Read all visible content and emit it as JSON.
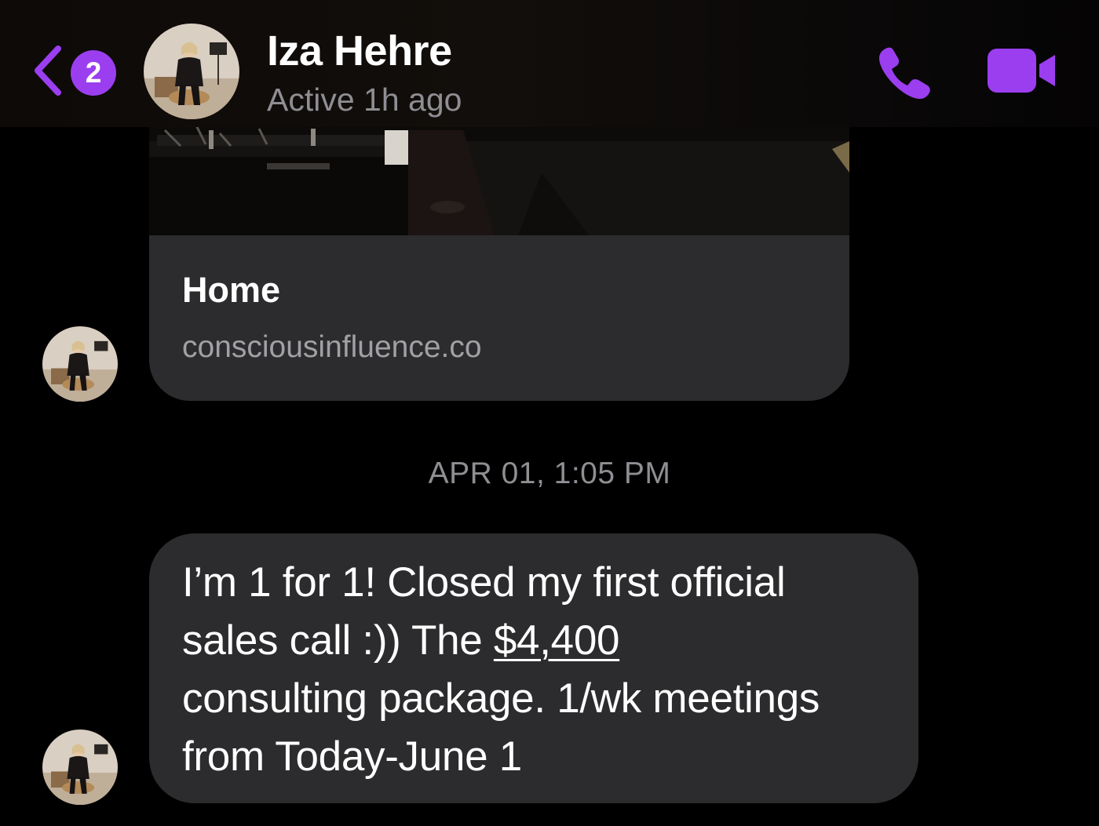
{
  "header": {
    "back_badge_count": "2",
    "contact_name": "Iza Hehre",
    "contact_status": "Active 1h ago",
    "accent_color": "#9b3ef0"
  },
  "icons": {
    "back": "chevron-left-icon",
    "call": "phone-icon",
    "video": "video-camera-icon"
  },
  "link_preview": {
    "title": "Home",
    "domain": "consciousinfluence.co"
  },
  "timestamp": "APR 01, 1:05 PM",
  "message": {
    "line1": "I’m 1 for 1! Closed my first official",
    "line2_before": "sales call :)) The ",
    "line2_link": "$4,400",
    "line3": "consulting package. 1/wk meetings",
    "line4": "from Today-June 1"
  }
}
